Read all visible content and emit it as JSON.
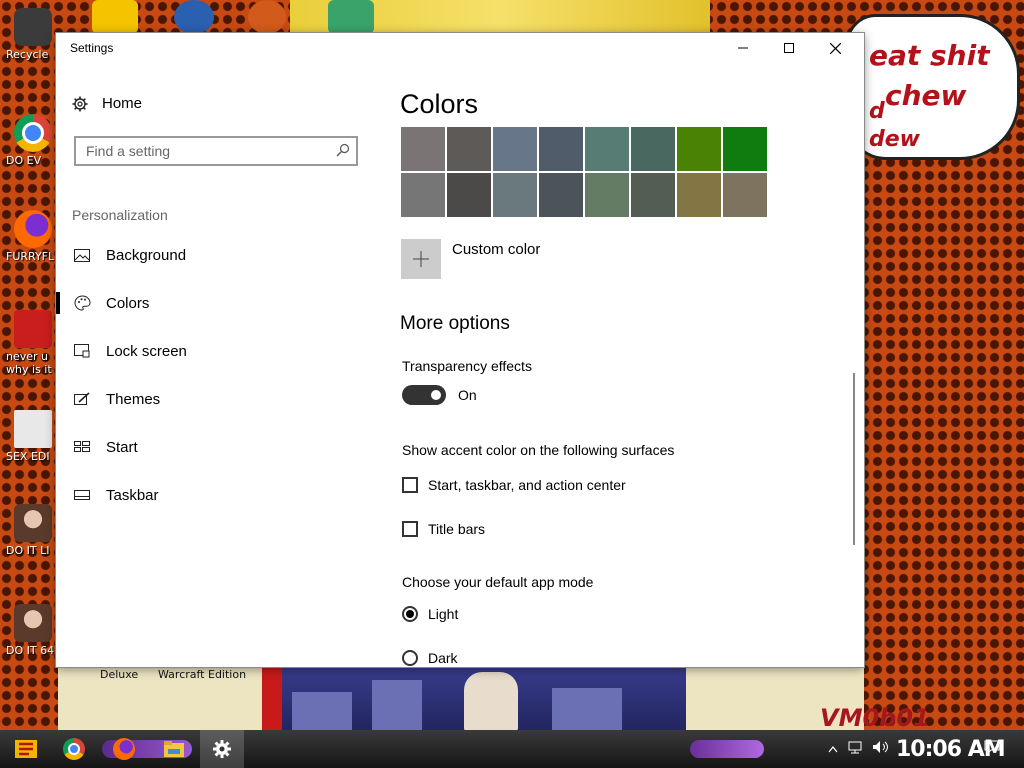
{
  "desktop": {
    "icons": [
      {
        "label": "Recycle",
        "icon": "recycle-bin-icon",
        "color": "#3b3b3b"
      },
      {
        "label": "DO EV",
        "icon": "chrome-icon",
        "color": "#2c7be5"
      },
      {
        "label": "FURRYFL",
        "icon": "firefox-icon",
        "color": "#e66000"
      },
      {
        "label": "never u",
        "label2": "why is it",
        "icon": "dev-cpp-icon",
        "color": "#c81e1e"
      },
      {
        "label": "SEX EDI",
        "icon": "hex-editor-icon",
        "color": "#3a7a3a"
      },
      {
        "label": "DO IT LI",
        "icon": "portrait-icon",
        "color": "#7a4a3a"
      },
      {
        "label": "DO IT 64",
        "icon": "portrait-icon",
        "color": "#7a4a3a"
      }
    ],
    "speech_bubble_lines": [
      "eat shit",
      "chew",
      "d",
      "dew"
    ],
    "under_labels": [
      "Deluxe",
      "Warcraft Edition"
    ],
    "logo_text": "VM0b01"
  },
  "window": {
    "title": "Settings",
    "controls": {
      "minimize": "—",
      "maximize": "☐",
      "close": "✕"
    }
  },
  "nav": {
    "home_label": "Home",
    "search_placeholder": "Find a setting",
    "section_label": "Personalization",
    "items": [
      {
        "label": "Background",
        "icon": "picture-icon"
      },
      {
        "label": "Colors",
        "icon": "palette-icon",
        "active": true
      },
      {
        "label": "Lock screen",
        "icon": "lock-screen-icon"
      },
      {
        "label": "Themes",
        "icon": "themes-icon"
      },
      {
        "label": "Start",
        "icon": "start-icon"
      },
      {
        "label": "Taskbar",
        "icon": "taskbar-icon"
      }
    ]
  },
  "content": {
    "heading": "Colors",
    "swatches": [
      "#7a7574",
      "#5d5a58",
      "#68768a",
      "#515c6b",
      "#567c73",
      "#486860",
      "#498205",
      "#107c10",
      "#767676",
      "#4c4a48",
      "#69797e",
      "#4a5459",
      "#647c64",
      "#525e54",
      "#847545",
      "#7e735f"
    ],
    "custom_color_label": "Custom color",
    "more_options_heading": "More options",
    "transparency_label": "Transparency effects",
    "transparency_state": "On",
    "accent_surfaces_label": "Show accent color on the following surfaces",
    "checkbox_start": "Start, taskbar, and action center",
    "checkbox_titlebars": "Title bars",
    "app_mode_label": "Choose your default app mode",
    "radio_light": "Light",
    "radio_dark": "Dark"
  },
  "taskbar": {
    "clock": "10:06 AM",
    "apps": [
      "start-icon",
      "chrome-icon",
      "firefox-icon",
      "file-explorer-icon",
      "settings-gear-icon"
    ]
  }
}
